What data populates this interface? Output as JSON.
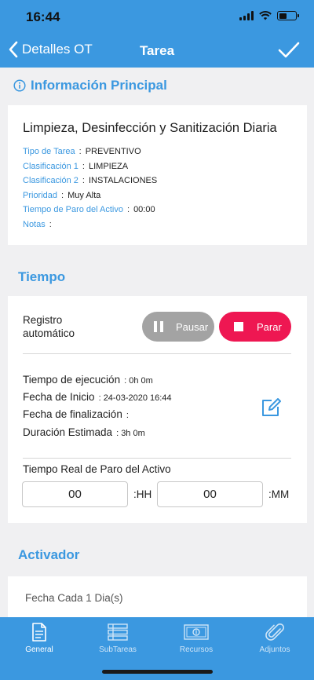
{
  "status_bar": {
    "time": "16:44",
    "battery_level": 0.45
  },
  "nav": {
    "back_label": "Detalles OT",
    "title": "Tarea"
  },
  "info": {
    "header": "Información Principal",
    "task_title": "Limpieza, Desinfección y Sanitización Diaria",
    "fields": [
      {
        "key": "Tipo de Tarea",
        "value": "PREVENTIVO"
      },
      {
        "key": "Clasificación 1",
        "value": "LIMPIEZA"
      },
      {
        "key": "Clasificación 2",
        "value": "INSTALACIONES"
      },
      {
        "key": "Prioridad",
        "value": "Muy Alta"
      },
      {
        "key": "Tiempo de Paro del Activo",
        "value": "00:00"
      },
      {
        "key": "Notas",
        "value": ""
      }
    ]
  },
  "tiempo": {
    "header": "Tiempo",
    "registro_label": "Registro automático",
    "pause_label": "Pausar",
    "stop_label": "Parar",
    "rows": [
      {
        "key": "Tiempo de ejecución",
        "value": "0h 0m"
      },
      {
        "key": "Fecha de Inicio",
        "value": "24-03-2020 16:44"
      },
      {
        "key": "Fecha de finalización",
        "value": ""
      },
      {
        "key": "Duración Estimada",
        "value": "3h 0m"
      }
    ],
    "paro_label": "Tiempo Real de Paro del Activo",
    "hours_value": "00",
    "hours_unit": ":HH",
    "minutes_value": "00",
    "minutes_unit": ":MM"
  },
  "activador": {
    "header": "Activador",
    "text": "Fecha Cada 1 Dia(s)"
  },
  "tabs": [
    {
      "label": "General",
      "icon": "document-icon",
      "active": true
    },
    {
      "label": "SubTareas",
      "icon": "list-icon",
      "active": false
    },
    {
      "label": "Recursos",
      "icon": "money-icon",
      "active": false
    },
    {
      "label": "Adjuntos",
      "icon": "paperclip-icon",
      "active": false
    }
  ],
  "colors": {
    "primary": "#3b98e0",
    "stop": "#ee1752",
    "pause": "#a3a3a3"
  }
}
